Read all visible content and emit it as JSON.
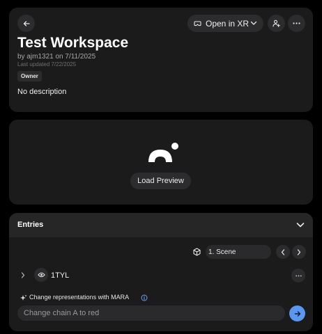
{
  "workspace": {
    "title": "Test Workspace",
    "author_line": "by ajm1321 on 7/11/2025",
    "updated_line": "Last updated 7/22/2025",
    "badge": "Owner",
    "description": "No description"
  },
  "toolbar": {
    "open_xr_label": "Open in XR"
  },
  "preview": {
    "load_label": "Load Preview"
  },
  "entries": {
    "title": "Entries",
    "scene_selected": "1. Scene",
    "items": [
      {
        "label": "1TYL"
      }
    ]
  },
  "mara": {
    "label": "Change representations with MARA",
    "placeholder": "Change chain A to red"
  },
  "icons": {
    "back": "arrow-left-icon",
    "open_xr": "vr-headset-icon",
    "open_xr_chevron": "chevron-down-icon",
    "share": "person-add-icon",
    "more": "more-horizontal-icon",
    "preview_logo": "dome-dot-logo",
    "collapse": "chevron-down-icon",
    "scene": "cube-icon",
    "prev": "chevron-left-icon",
    "next": "chevron-right-icon",
    "expand": "chevron-right-icon",
    "visibility": "eye-icon",
    "sparkle": "sparkle-icon",
    "info": "info-icon",
    "send": "arrow-right-icon"
  },
  "colors": {
    "background": "#000000",
    "card": "#1b1b1c",
    "accent": "#5b97f0"
  }
}
